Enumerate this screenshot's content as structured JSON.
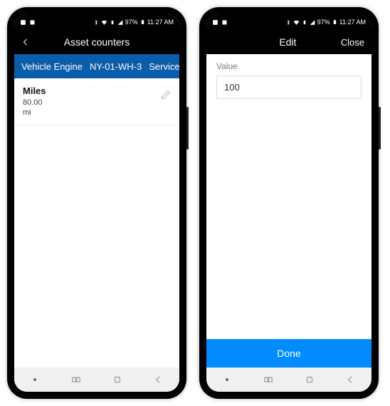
{
  "status": {
    "battery": "97%",
    "time": "11:27 AM"
  },
  "left_phone": {
    "title": "Asset counters",
    "context": {
      "asset_type": "Vehicle Engine",
      "asset_id": "NY-01-WH-3",
      "service": "Service"
    },
    "counter": {
      "name": "Miles",
      "value": "80.00",
      "unit": "mi"
    }
  },
  "right_phone": {
    "title": "Edit",
    "close_label": "Close",
    "field_label": "Value",
    "field_value": "100",
    "done_label": "Done"
  }
}
